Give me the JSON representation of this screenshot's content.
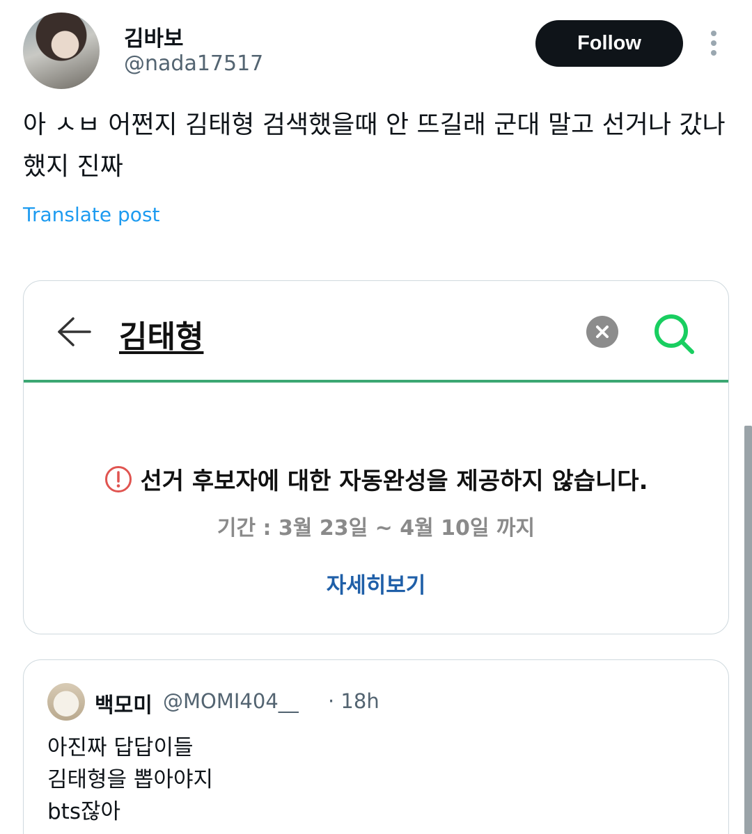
{
  "author": {
    "name": "김바보",
    "handle": "@nada17517"
  },
  "actions": {
    "follow_label": "Follow",
    "more_icon": "more-vertical-icon"
  },
  "post": {
    "text": "아 ㅅㅂ 어쩐지 김태형 검색했을때 안 뜨길래 군대 말고 선거나 갔나했지 진짜",
    "translate_label": "Translate post"
  },
  "card": {
    "search_query": "김태형",
    "notice": "선거 후보자에 대한 자동완성을 제공하지 않습니다.",
    "period": "기간 : 3월 23일 ~ 4월 10일 까지",
    "details_link": "자세히보기",
    "accent_color": "#3ca773"
  },
  "quote": {
    "name": "백모미",
    "handle": "@MOMI404__",
    "time": "· 18h",
    "lines": [
      "아진짜 답답이들",
      "김태형을 뽑아야지",
      "bts잖아"
    ]
  }
}
